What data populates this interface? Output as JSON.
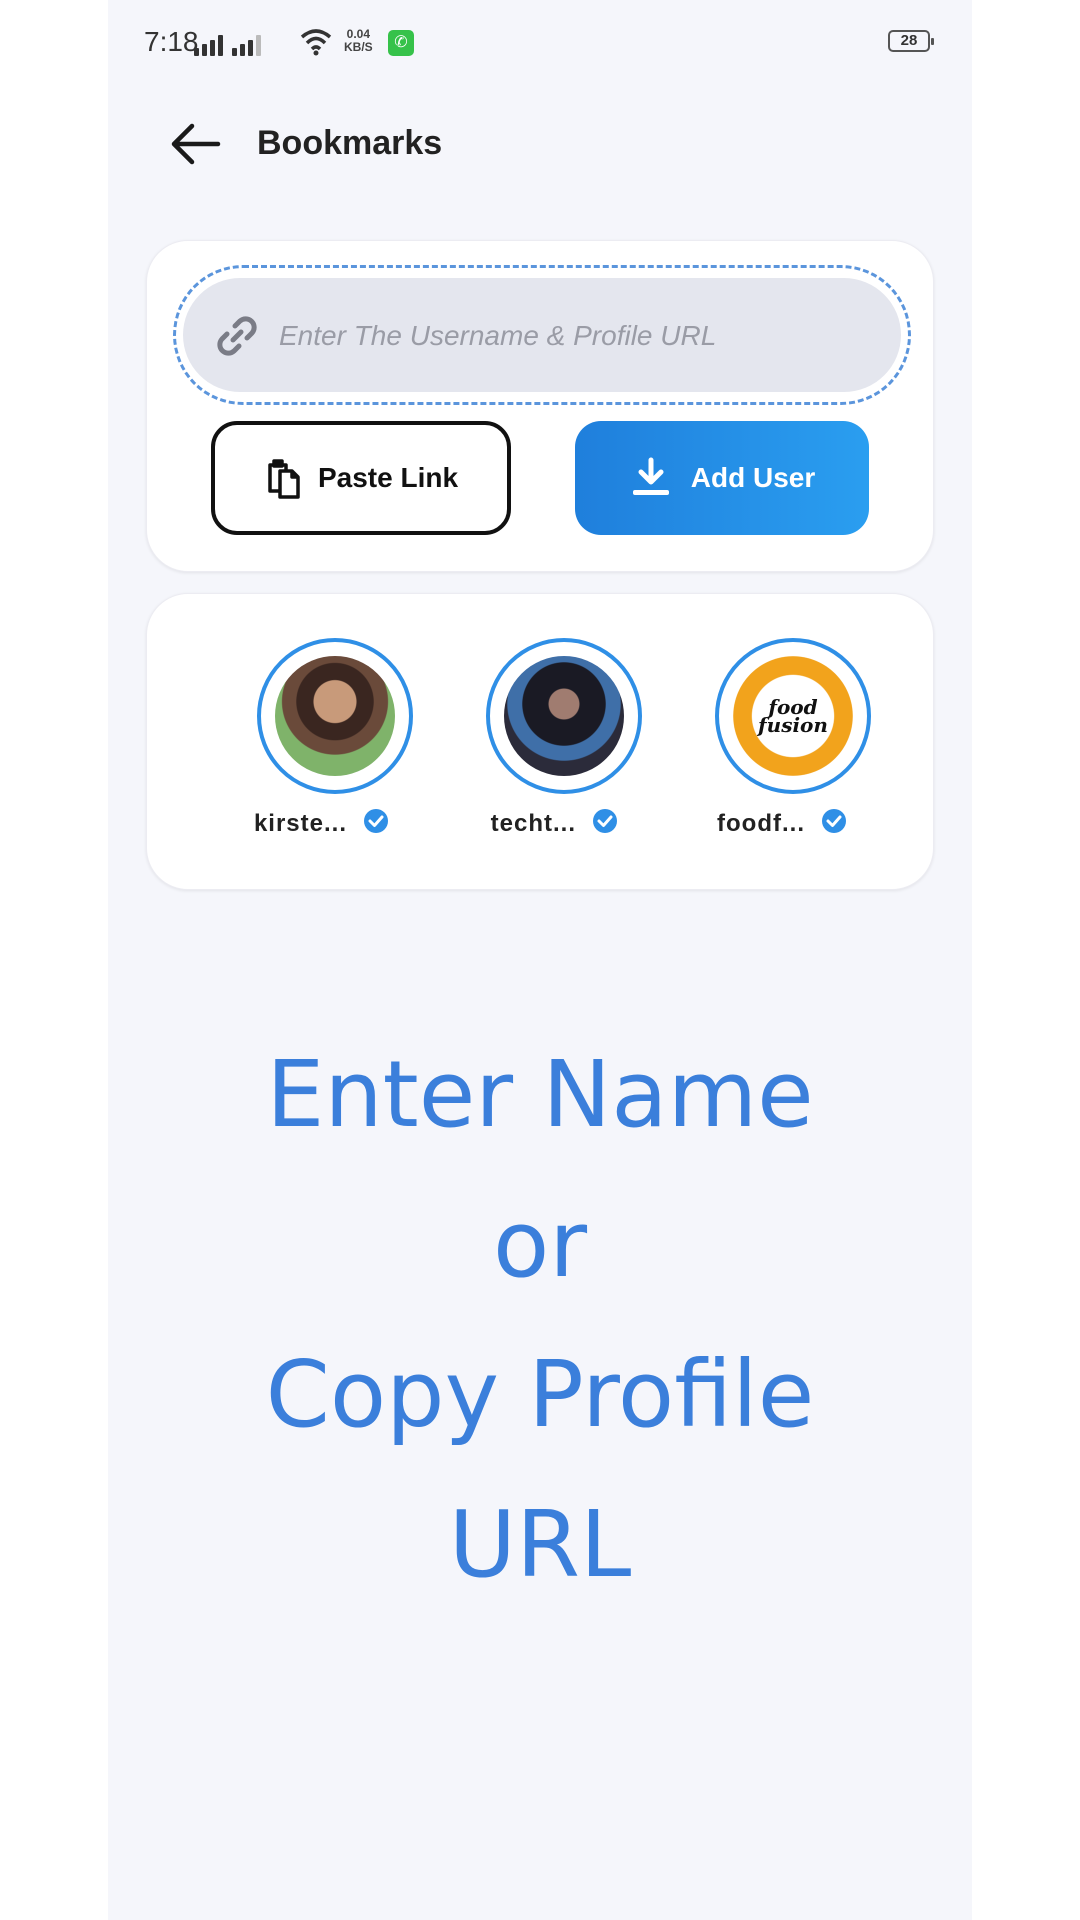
{
  "status_bar": {
    "time": "7:18",
    "net_speed_value": "0.04",
    "net_speed_unit": "KB/S",
    "battery": "28",
    "notification_icon": "whatsapp-icon"
  },
  "header": {
    "title": "Bookmarks",
    "back_icon": "arrow-left-icon"
  },
  "search": {
    "placeholder": "Enter The Username & Profile URL",
    "value": ""
  },
  "buttons": {
    "paste_label": "Paste Link",
    "add_label": "Add User"
  },
  "users": [
    {
      "name": "kirste...",
      "verified": true
    },
    {
      "name": "techt...",
      "verified": true
    },
    {
      "name": "foodf...",
      "verified": true,
      "logo_line1": "food",
      "logo_line2": "fusion"
    }
  ],
  "prompt": {
    "line1": "Enter Name",
    "line2": "or",
    "line3": "Copy Profile",
    "line4": "URL"
  },
  "colors": {
    "accent": "#2f8fe6",
    "prompt_text": "#3b7fdb",
    "background": "#f5f6fb"
  }
}
